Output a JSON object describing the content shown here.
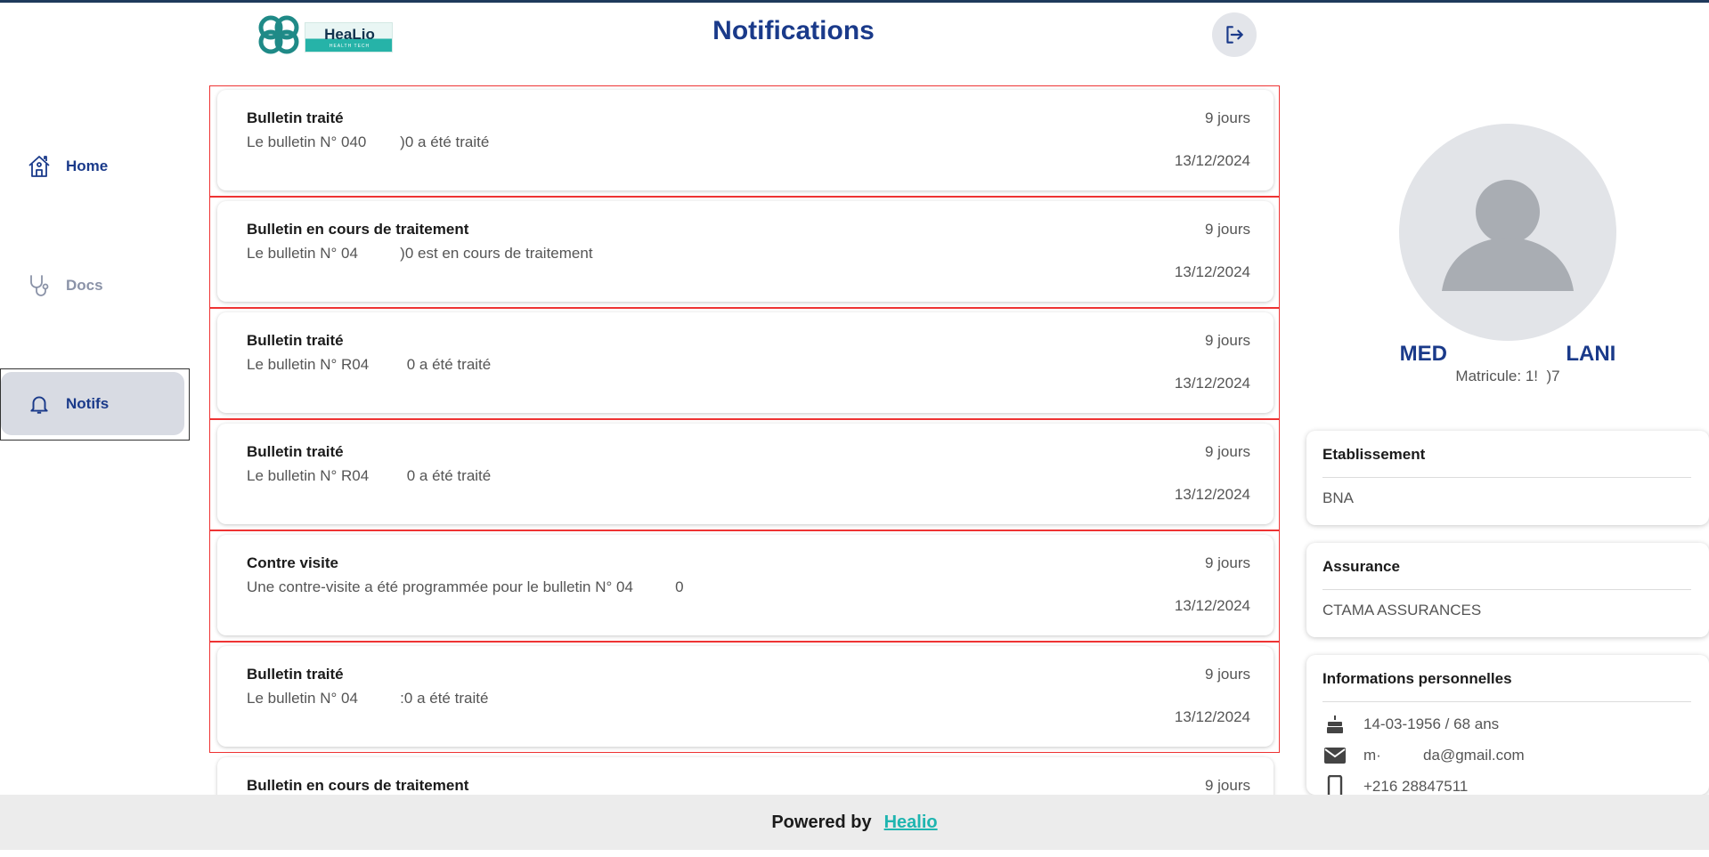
{
  "header": {
    "logo_text": "HeaLio",
    "logo_subtext": "HEALTH TECH",
    "title": "Notifications"
  },
  "sidebar": {
    "items": [
      {
        "label": "Home",
        "icon": "home-icon"
      },
      {
        "label": "Docs",
        "icon": "stethoscope-icon"
      },
      {
        "label": "Notifs",
        "icon": "bell-icon",
        "active": true
      }
    ]
  },
  "notifications": [
    {
      "title": "Bulletin traité",
      "message": "Le bulletin N° 040        )0 a été traité",
      "age": "9 jours",
      "date": "13/12/2024"
    },
    {
      "title": "Bulletin en cours de traitement",
      "message": "Le bulletin N° 04          )0 est en cours de traitement",
      "age": "9 jours",
      "date": "13/12/2024"
    },
    {
      "title": "Bulletin traité",
      "message": "Le bulletin N° R04         0 a été traité",
      "age": "9 jours",
      "date": "13/12/2024"
    },
    {
      "title": "Bulletin traité",
      "message": "Le bulletin N° R04         0 a été traité",
      "age": "9 jours",
      "date": "13/12/2024"
    },
    {
      "title": "Contre visite",
      "message": "Une contre-visite a été programmée pour le bulletin N° 04          0",
      "age": "9 jours",
      "date": "13/12/2024"
    },
    {
      "title": "Bulletin traité",
      "message": "Le bulletin N° 04          :0 a été traité",
      "age": "9 jours",
      "date": "13/12/2024"
    },
    {
      "title": "Bulletin en cours de traitement",
      "message": "",
      "age": "9 jours",
      "date": ""
    }
  ],
  "profile": {
    "name": "MED                    LANI",
    "matricule": "Matricule: 1!  )7",
    "etablissement_label": "Etablissement",
    "etablissement": "BNA",
    "assurance_label": "Assurance",
    "assurance": "CTAMA ASSURANCES",
    "perso_label": "Informations personnelles",
    "birth": "14-03-1956 / 68 ans",
    "email": "m·          da@gmail.com",
    "phone": "+216 28847511"
  },
  "footer": {
    "powered_by": "Powered by",
    "brand": "Healio"
  },
  "colors": {
    "primary": "#1a3a8a",
    "accent": "#1fb5b0",
    "notif_border": "#ee3333",
    "sidebar_active_bg": "#d8dbe3"
  }
}
